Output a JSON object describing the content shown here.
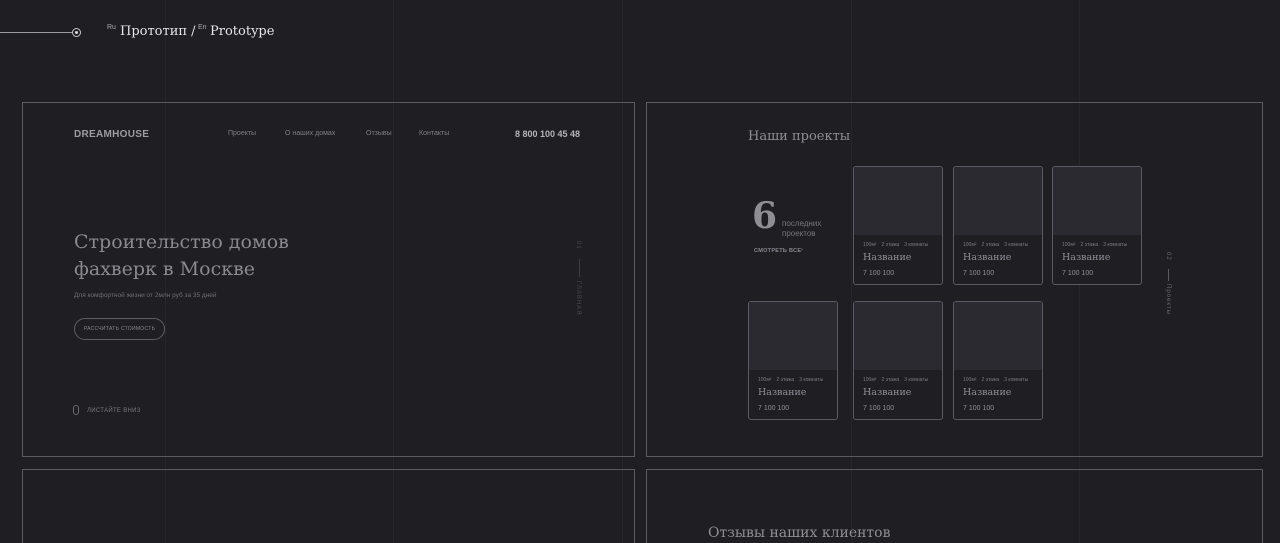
{
  "header": {
    "ru_tag": "Ru",
    "ru_label": "Прототип /",
    "en_tag": "En",
    "en_label": "Prototype"
  },
  "hero_frame": {
    "brand": "DREAMHOUSE",
    "nav": [
      "Проекты",
      "О наших домах",
      "Отзывы",
      "Контакты"
    ],
    "phone": "8 800 100 45 48",
    "title_line1": "Строительство домов",
    "title_line2": "фахверк в Москве",
    "subtitle": "Для комфортной жизни от 2млн руб за 35 дней",
    "cta_label": "РАССЧИТАТЬ СТОИМОСТЬ",
    "scroll_label": "ЛИСТАЙТЕ ВНИЗ",
    "side_number": "01",
    "side_label": "ГЛАВНАЯ"
  },
  "projects_frame": {
    "title": "Наши проекты",
    "count": "6",
    "count_label_1": "последних",
    "count_label_2": "проектов",
    "see_all": "СМОТРЕТЬ ВСЕ",
    "side_number": "02",
    "side_label": "Проекты",
    "cards": [
      {
        "area": "100м²",
        "floors": "2 этажа",
        "rooms": "3 комнаты",
        "name": "Название",
        "price": "7 100 100"
      },
      {
        "area": "100м²",
        "floors": "2 этажа",
        "rooms": "3 комнаты",
        "name": "Название",
        "price": "7 100 100"
      },
      {
        "area": "100м²",
        "floors": "2 этажа",
        "rooms": "3 комнаты",
        "name": "Название",
        "price": "7 100 100"
      },
      {
        "area": "100м²",
        "floors": "2 этажа",
        "rooms": "3 комнаты",
        "name": "Название",
        "price": "7 100 100"
      },
      {
        "area": "100м²",
        "floors": "2 этажа",
        "rooms": "3 комнаты",
        "name": "Название",
        "price": "7 100 100"
      },
      {
        "area": "100м²",
        "floors": "2 этажа",
        "rooms": "3 комнаты",
        "name": "Название",
        "price": "7 100 100"
      }
    ]
  },
  "reviews_frame": {
    "title": "Отзывы наших клиентов"
  }
}
